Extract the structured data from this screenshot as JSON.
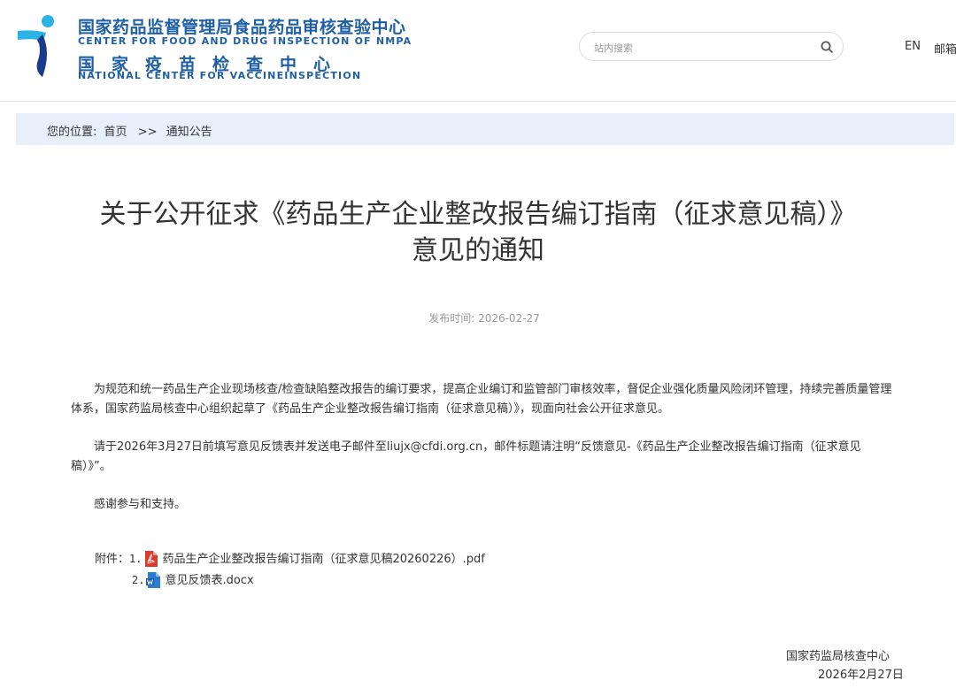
{
  "header": {
    "logo_cn_1": "国家药品监督管理局食品药品审核查验中心",
    "logo_en_1": "CENTER FOR FOOD AND DRUG INSPECTION OF NMPA",
    "logo_cn_2": "国家疫苗检查中心",
    "logo_en_2": "NATIONAL CENTER FOR VACCINEINSPECTION",
    "search_placeholder": "站内搜索",
    "lang_link": "EN",
    "mail_link": "邮箱"
  },
  "breadcrumb": {
    "label": "您的位置:",
    "home": "首页",
    "separator": ">>",
    "current": "通知公告"
  },
  "article": {
    "title_line1": "关于公开征求《药品生产企业整改报告编订指南（征求意见稿）》",
    "title_line2": "意见的通知",
    "publish_label": "发布时间:",
    "publish_date": "2026-02-27",
    "paragraphs": [
      "为规范和统一药品生产企业现场核查/检查缺陷整改报告的编订要求，提高企业编订和监管部门审核效率，督促企业强化质量风险闭环管理，持续完善质量管理体系，国家药监局核查中心组织起草了《药品生产企业整改报告编订指南（征求意见稿）》，现面向社会公开征求意见。",
      "请于2026年3月27日前填写意见反馈表并发送电子邮件至liujx@cfdi.org.cn，邮件标题请注明“反馈意见-《药品生产企业整改报告编订指南（征求意见稿）》”。",
      "感谢参与和支持。"
    ],
    "attachments_label": "附件：",
    "attachments": [
      {
        "num": "1.",
        "name": "药品生产企业整改报告编订指南（征求意见稿20260226）.pdf",
        "icon": "pdf-file-icon"
      },
      {
        "num": "2.",
        "name": "意见反馈表.docx",
        "icon": "word-file-icon"
      }
    ],
    "signature_org": "国家药监局核查中心",
    "signature_date": "2026年2月27日"
  },
  "colors": {
    "brand_blue": "#1f5fa6",
    "logo_cyan": "#2ab4e6",
    "logo_navy": "#1b3a8c",
    "breadcrumb_bg": "#e7f0fa",
    "pdf_red": "#e0382c",
    "word_blue": "#2b7cd3"
  }
}
